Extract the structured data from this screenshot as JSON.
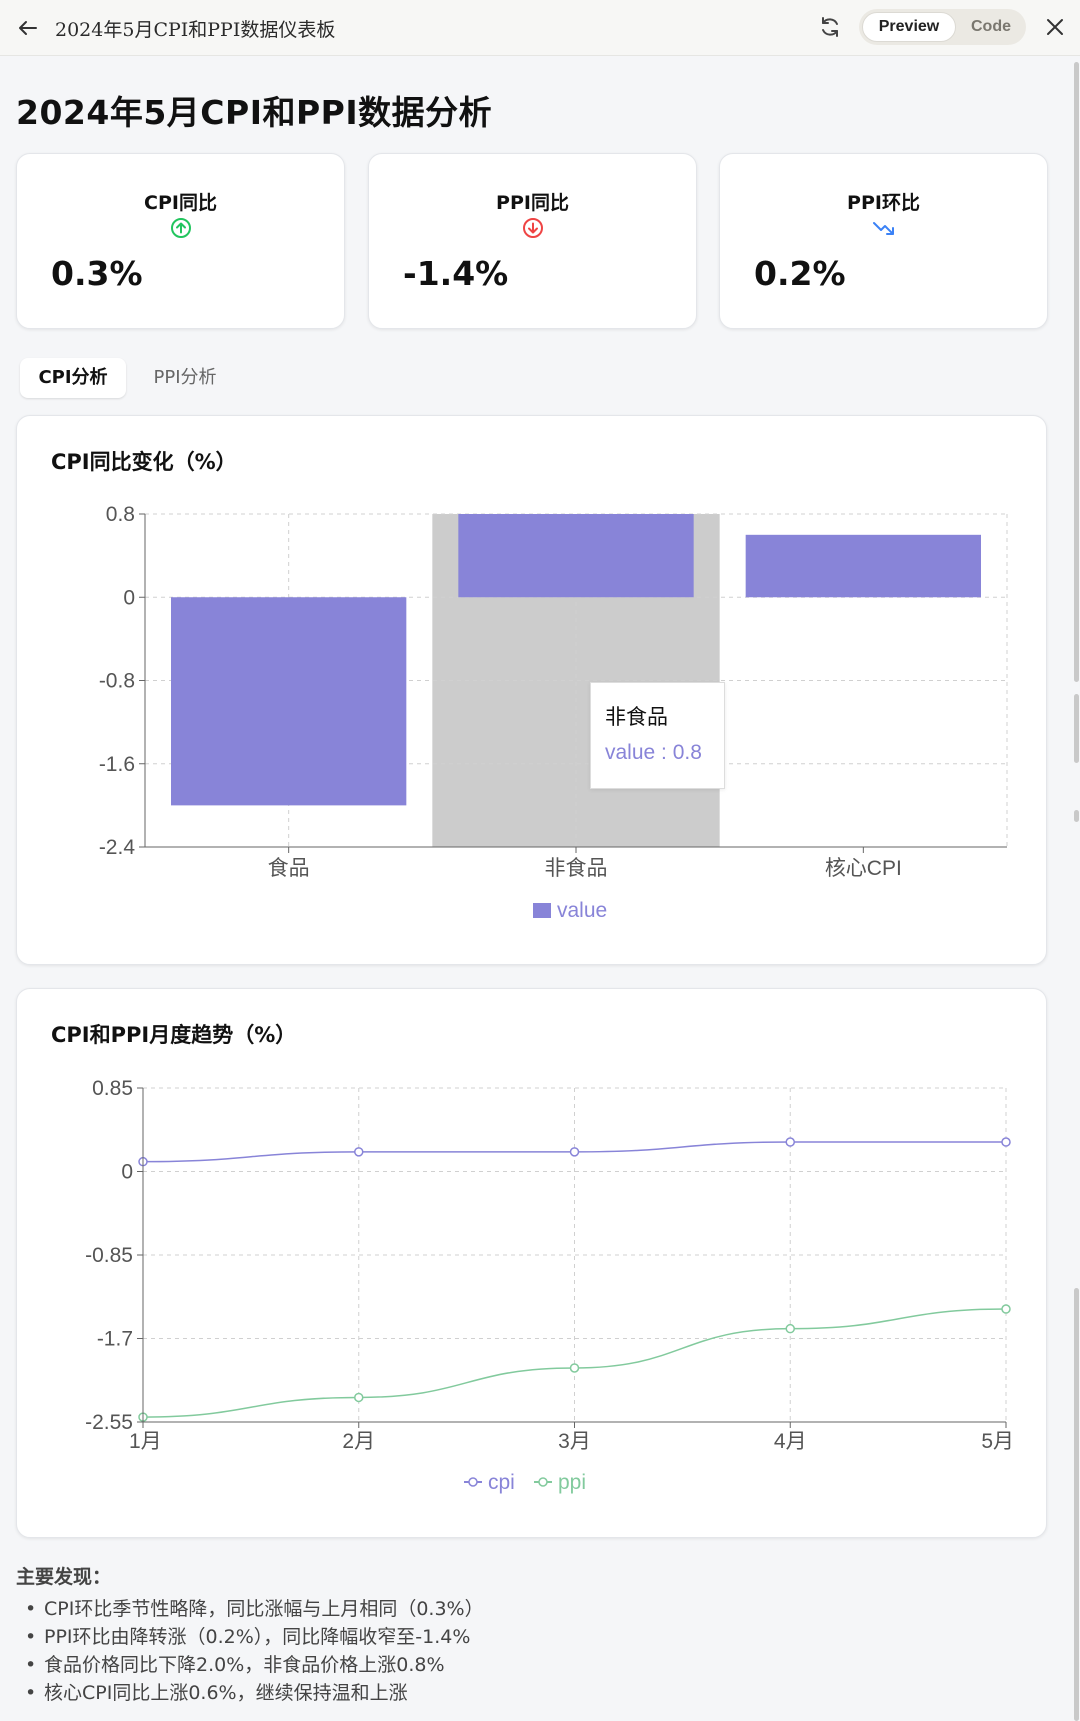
{
  "window": {
    "title": "2024年5月CPI和PPI数据仪表板",
    "toggle_preview": "Preview",
    "toggle_code": "Code"
  },
  "page": {
    "title": "2024年5月CPI和PPI数据分析"
  },
  "stats": [
    {
      "label": "CPI同比",
      "value": "0.3%",
      "icon": "arrow-up-circle-icon",
      "color": "#22c55e"
    },
    {
      "label": "PPI同比",
      "value": "-1.4%",
      "icon": "arrow-down-circle-icon",
      "color": "#ef4444"
    },
    {
      "label": "PPI环比",
      "value": "0.2%",
      "icon": "trending-down-icon",
      "color": "#3b82f6"
    }
  ],
  "tabs": [
    {
      "label": "CPI分析",
      "active": true
    },
    {
      "label": "PPI分析",
      "active": false
    }
  ],
  "bar_chart_card": {
    "title": "CPI同比变化（%）",
    "tooltip": {
      "name": "非食品",
      "value_text": "value : 0.8"
    }
  },
  "line_chart_card": {
    "title": "CPI和PPI月度趋势（%）"
  },
  "chart_data": [
    {
      "type": "bar",
      "categories": [
        "食品",
        "非食品",
        "核心CPI"
      ],
      "series": [
        {
          "name": "value",
          "values": [
            -2.0,
            0.8,
            0.6
          ],
          "color": "#8884d8"
        }
      ],
      "yticks": [
        0.8,
        0,
        -0.8,
        -1.6,
        -2.4
      ],
      "ylim": [
        -2.4,
        0.8
      ],
      "grid": true,
      "legend": "bottom",
      "highlighted_category": "非食品"
    },
    {
      "type": "line",
      "categories": [
        "1月",
        "2月",
        "3月",
        "4月",
        "5月"
      ],
      "series": [
        {
          "name": "cpi",
          "values": [
            0.1,
            0.2,
            0.2,
            0.3,
            0.3
          ],
          "color": "#8884d8"
        },
        {
          "name": "ppi",
          "values": [
            -2.5,
            -2.3,
            -2.0,
            -1.6,
            -1.4
          ],
          "color": "#82ca9d"
        }
      ],
      "yticks": [
        0.85,
        0,
        -0.85,
        -1.7,
        -2.55
      ],
      "ylim": [
        -2.55,
        0.85
      ],
      "grid": true,
      "legend": "bottom"
    }
  ],
  "findings": {
    "title": "主要发现：",
    "items": [
      "CPI环比季节性略降，同比涨幅与上月相同（0.3%）",
      "PPI环比由降转涨（0.2%），同比降幅收窄至-1.4%",
      "食品价格同比下降2.0%，非食品价格上涨0.8%",
      "核心CPI同比上涨0.6%，继续保持温和上涨"
    ]
  }
}
